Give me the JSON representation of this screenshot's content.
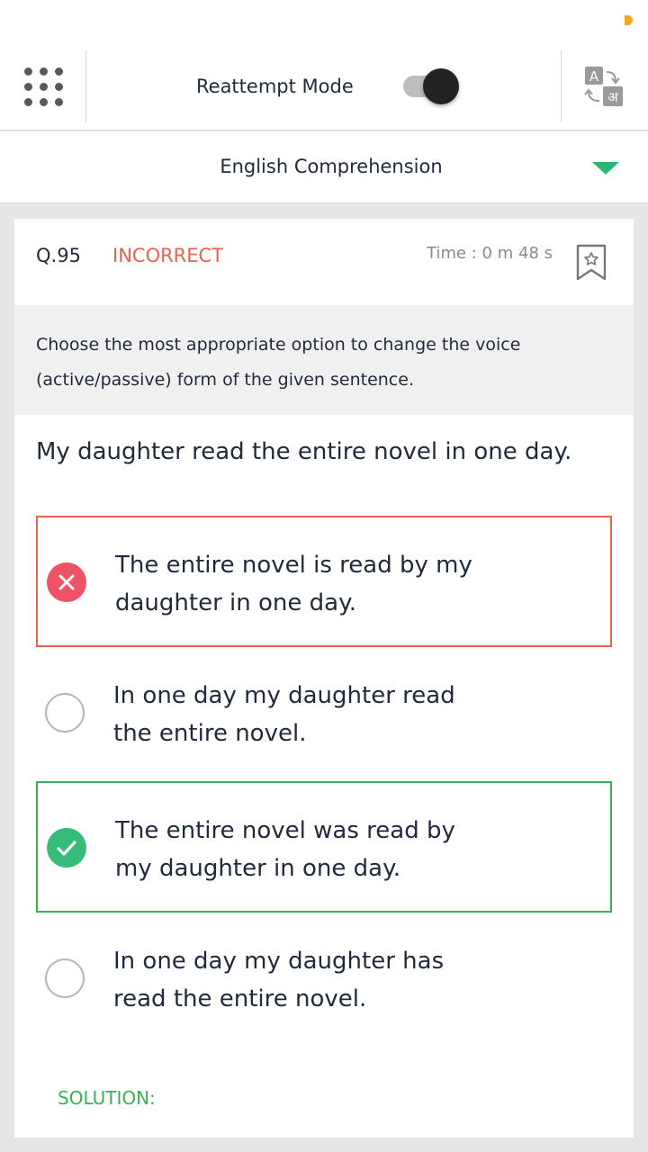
{
  "header": {
    "mode_label": "Reattempt Mode",
    "mode_enabled": true,
    "menu_icon": "grid-dots-icon",
    "translate_icon": "translate-icon",
    "translate_glyph_latin": "A",
    "translate_glyph_hindi": "अ"
  },
  "section": {
    "title": "English Comprehension",
    "dropdown_icon": "caret-down-icon",
    "accent_color": "#2bb673"
  },
  "question": {
    "number": "Q.95",
    "status": "INCORRECT",
    "time": "Time : 0 m 48 s",
    "bookmark_icon": "bookmark-star-icon",
    "instruction": "Choose the most appropriate option to change the voice (active/passive) form of the given sentence.",
    "sentence": "My daughter read the entire novel in one day.",
    "options": [
      {
        "text": "The entire novel is read by my daughter in one day.",
        "state": "incorrect-selected"
      },
      {
        "text": "In one day my daughter read the entire novel.",
        "state": "unselected"
      },
      {
        "text": "The entire novel was read by my daughter in one day.",
        "state": "correct"
      },
      {
        "text": "In one day my daughter has read the entire novel.",
        "state": "unselected"
      }
    ]
  },
  "solution": {
    "label": "SOLUTION:"
  },
  "colors": {
    "incorrect": "#e8624f",
    "correct": "#3cb056",
    "wrong_icon": "#ef5466",
    "right_icon": "#35bc78"
  }
}
